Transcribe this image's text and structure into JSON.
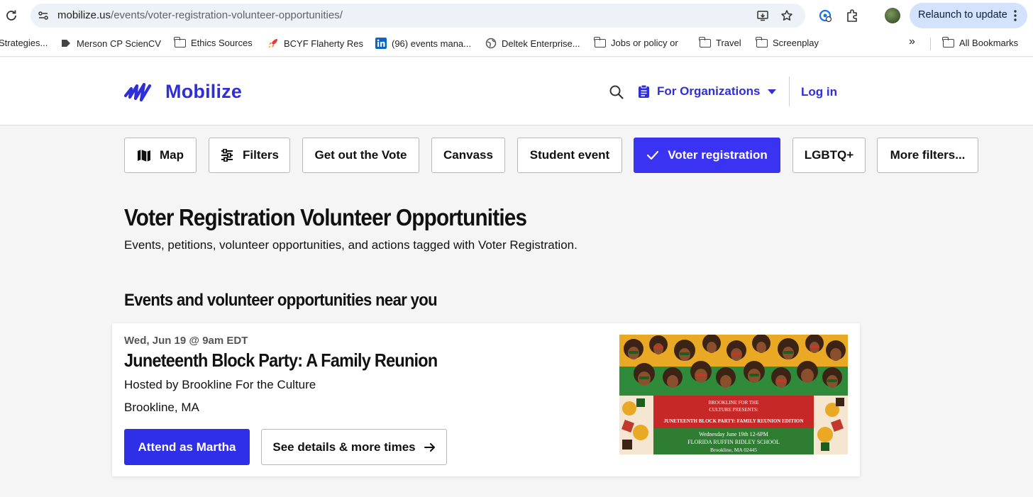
{
  "browser": {
    "url_host": "mobilize.us",
    "url_path": "/events/voter-registration-volunteer-opportunities/",
    "relaunch_label": "Relaunch to update",
    "bookmarks": [
      {
        "label": "Strategies...",
        "icon": "page-icon"
      },
      {
        "label": "Merson CP ScienCV",
        "icon": "scienCV-icon"
      },
      {
        "label": "Ethics Sources",
        "icon": "folder-icon"
      },
      {
        "label": "BCYF Flaherty Res",
        "icon": "rocket-icon"
      },
      {
        "label": "(96) events mana...",
        "icon": "linkedin-icon"
      },
      {
        "label": "Deltek Enterprise...",
        "icon": "globe-icon"
      },
      {
        "label": "Jobs or policy or",
        "icon": "folder-icon"
      },
      {
        "label": "Travel",
        "icon": "folder-icon"
      },
      {
        "label": "Screenplay",
        "icon": "folder-icon"
      }
    ],
    "more_bookmarks": "»",
    "all_bookmarks": "All Bookmarks"
  },
  "header": {
    "logo_text": "Mobilize",
    "orgs_label": "For Organizations",
    "login_label": "Log in",
    "brand_color": "#2f2fd9"
  },
  "filters": [
    {
      "label": "Map",
      "icon": "map-icon",
      "active": false
    },
    {
      "label": "Filters",
      "icon": "sliders-icon",
      "active": false
    },
    {
      "label": "Get out the Vote",
      "active": false
    },
    {
      "label": "Canvass",
      "active": false
    },
    {
      "label": "Student event",
      "active": false
    },
    {
      "label": "Voter registration",
      "icon": "check-icon",
      "active": true
    },
    {
      "label": "LGBTQ+",
      "active": false
    },
    {
      "label": "More filters...",
      "active": false
    }
  ],
  "page": {
    "title": "Voter Registration Volunteer Opportunities",
    "subtitle": "Events, petitions, volunteer opportunities, and actions tagged with Voter Registration.",
    "section_title": "Events and volunteer opportunities near you"
  },
  "event": {
    "date": "Wed, Jun 19 @ 9am EDT",
    "title": "Juneteenth Block Party: A Family Reunion",
    "host": "Hosted by Brookline For the Culture",
    "location": "Brookline, MA",
    "attend_label": "Attend as Martha",
    "details_label": "See details & more times",
    "image": {
      "line1": "BROOKLINE FOR THE",
      "line2": "CULTURE PRESENTS:",
      "line3": "JUNETEENTH BLOCK PARTY: FAMILY REUNION EDITION",
      "line4": "Wednesday June 19th 12-6PM",
      "line5": "FLORIDA RUFFIN RIDLEY SCHOOL",
      "line6": "Brookline, MA 02445"
    }
  }
}
